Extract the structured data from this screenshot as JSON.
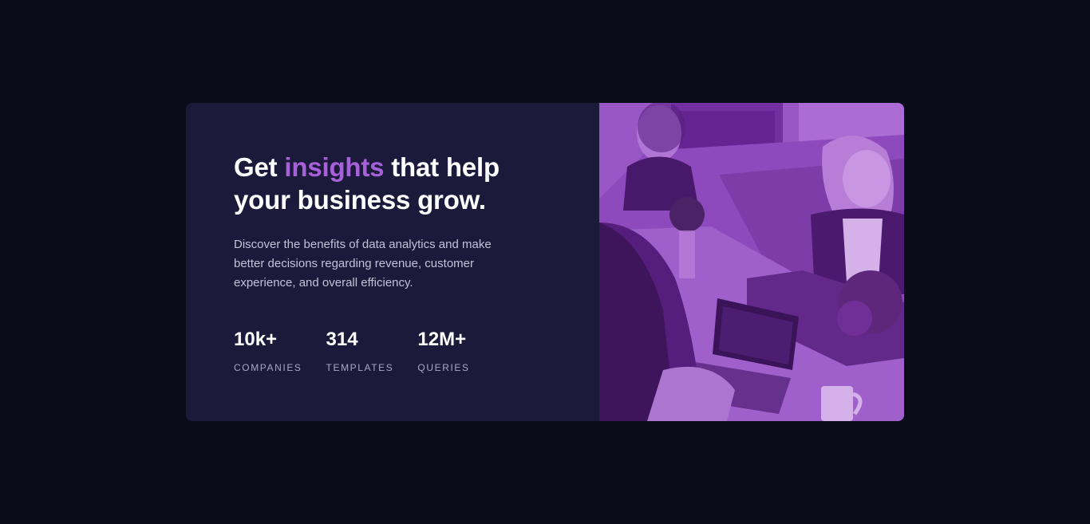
{
  "hero": {
    "headline_before": "Get ",
    "headline_accent": "insights",
    "headline_after": " that help your business grow.",
    "description": "Discover the benefits of data analytics and make better decisions regarding revenue, customer experience, and overall efficiency."
  },
  "stats": [
    {
      "value": "10k+",
      "label": "COMPANIES"
    },
    {
      "value": "314",
      "label": "TEMPLATES"
    },
    {
      "value": "12M+",
      "label": "QUERIES"
    }
  ],
  "image": {
    "description_icon": "office-team-photo"
  },
  "colors": {
    "page_background": "#0a0c1a",
    "card_background": "#1c1a3b",
    "accent": "#a661d8",
    "image_tint": "#8c4ab7"
  }
}
